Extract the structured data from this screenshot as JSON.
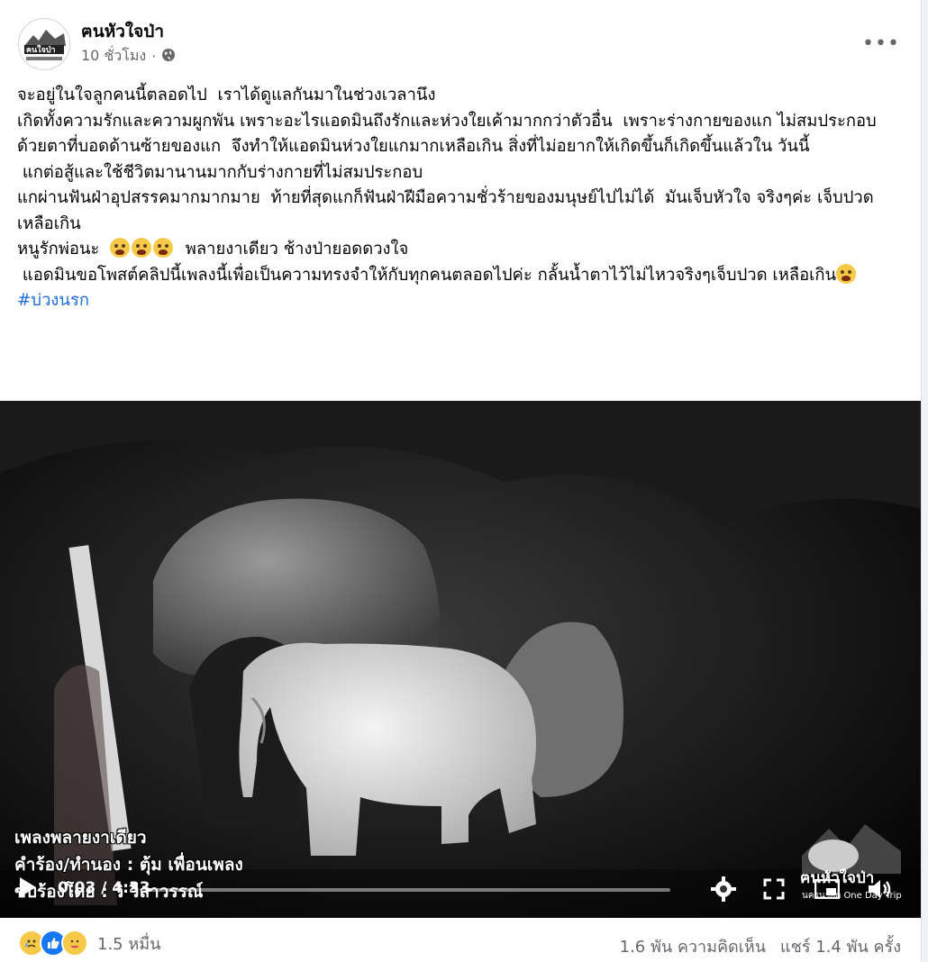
{
  "post": {
    "author": "ฅนหัวใจป่า",
    "time": "10 ชั่วโมง",
    "privacy_icon": "globe-icon",
    "more_icon": "more-icon",
    "lines": [
      "จะอยู่ในใจลูกคนนี้ตลอดไป  เราได้ดูแลกันมาในช่วงเวลานึง",
      "เกิดทั้งความรักและความผูกพัน เพราะอะไรแอดมินถึงรักและห่วงใยเค้ามากกว่าตัวอื่น  เพราะร่างกายของแก ไม่สมประกอบ",
      "ด้วยตาที่บอดด้านซ้ายของแก  จึงทำให้แอดมินห่วงใยแกมากเหลือเกิน สิ่งที่ไม่อยากให้เกิดขึ้นก็เกิดขึ้นแล้วใน วันนี้",
      " แกต่อสู้และใช้ชีวิตมานานมากกับร่างกายที่ไม่สมประกอบ",
      "แกผ่านฟันฝ่าอุปสรรคมากมากมาย  ท้ายที่สุดแกก็ฟันฝ่าฝีมือความชั่วร้ายของมนุษย์ไปไม่ได้  มันเจ็บหัวใจ จริงๆค่ะ เจ็บปวดเหลือเกิน"
    ],
    "line_love_prefix": "หนูรักพ่อนะ  ",
    "line_love_suffix": "  พลายงาเดียว ช้างป่ายอดดวงใจ",
    "line_last": " แอดมินขอโพสต์คลิปนี้เพลงนี้เพื่อเป็นความทรงจำให้กับทุกคนตลอดไปค่ะ กลั้นน้ำตาไว้ไม่ไหวจริงๆเจ็บปวด เหลือเกิน",
    "hashtag": "#บ่วงนรก"
  },
  "video": {
    "caption_1": "เพลงพลายงาเดียว",
    "caption_2": "คำร้อง/ทำนอง : ตุ้ม เพื่อนเพลง",
    "caption_3": "ขับร้องโดย : วิ วิลาวรรณ์",
    "current_time": "0:03",
    "duration": "4:33",
    "progress": 0.011,
    "watermark_logo": "ฅนหัวใจป่า",
    "watermark_sub": "นครนายก One Day Trip"
  },
  "footer": {
    "reaction_count": "1.5 หมื่น",
    "comments": "1.6 พัน ความคิดเห็น",
    "shares": "แชร์ 1.4 พัน ครั้ง"
  }
}
